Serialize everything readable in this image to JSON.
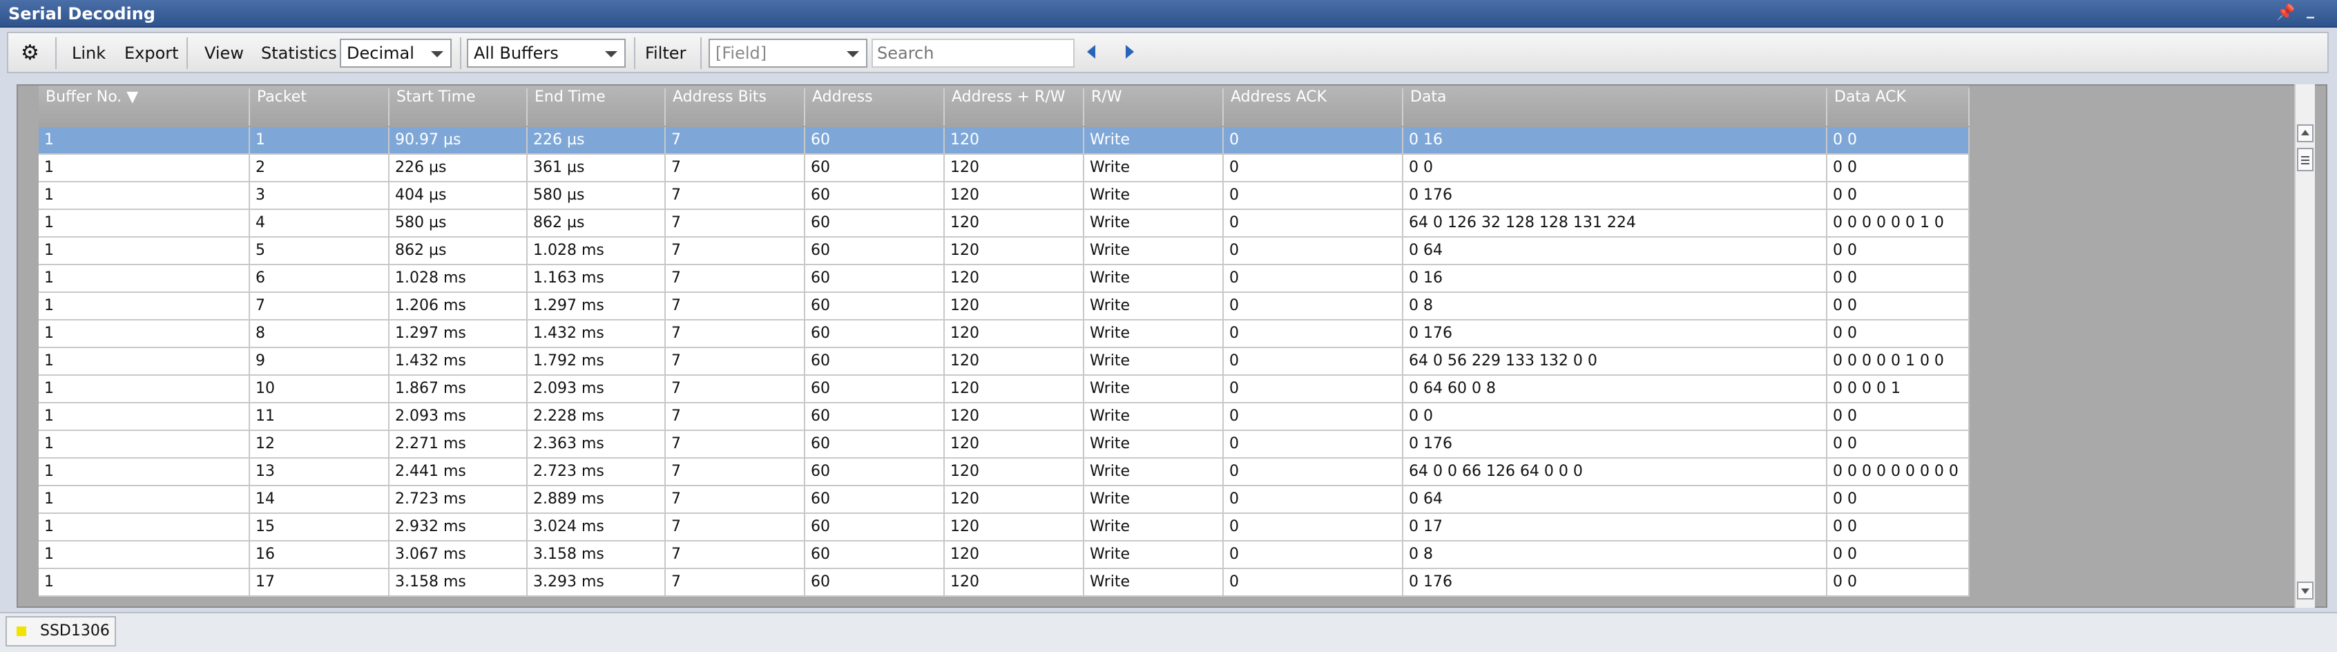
{
  "window": {
    "title": "Serial Decoding"
  },
  "toolbar": {
    "link_label": "Link",
    "export_label": "Export",
    "view_label": "View",
    "statistics_label": "Statistics",
    "format_value": "Decimal",
    "buffers_value": "All Buffers",
    "filter_label": "Filter",
    "field_placeholder": "[Field]",
    "search_placeholder": "Search"
  },
  "table": {
    "columns": [
      "Buffer No. ▼",
      "Packet",
      "Start Time",
      "End Time",
      "Address Bits",
      "Address",
      "Address + R/W",
      "R/W",
      "Address ACK",
      "Data",
      "Data ACK"
    ],
    "rows": [
      [
        "1",
        "1",
        "90.97 µs",
        "226 µs",
        "7",
        "60",
        "120",
        "Write",
        "0",
        "0 16",
        "0 0"
      ],
      [
        "1",
        "2",
        "226 µs",
        "361 µs",
        "7",
        "60",
        "120",
        "Write",
        "0",
        "0 0",
        "0 0"
      ],
      [
        "1",
        "3",
        "404 µs",
        "580 µs",
        "7",
        "60",
        "120",
        "Write",
        "0",
        "0 176",
        "0 0"
      ],
      [
        "1",
        "4",
        "580 µs",
        "862 µs",
        "7",
        "60",
        "120",
        "Write",
        "0",
        "64 0 126 32 128 128 131 224",
        "0 0 0 0 0 0 1 0"
      ],
      [
        "1",
        "5",
        "862 µs",
        "1.028 ms",
        "7",
        "60",
        "120",
        "Write",
        "0",
        "0 64",
        "0 0"
      ],
      [
        "1",
        "6",
        "1.028 ms",
        "1.163 ms",
        "7",
        "60",
        "120",
        "Write",
        "0",
        "0 16",
        "0 0"
      ],
      [
        "1",
        "7",
        "1.206 ms",
        "1.297 ms",
        "7",
        "60",
        "120",
        "Write",
        "0",
        "0 8",
        "0 0"
      ],
      [
        "1",
        "8",
        "1.297 ms",
        "1.432 ms",
        "7",
        "60",
        "120",
        "Write",
        "0",
        "0 176",
        "0 0"
      ],
      [
        "1",
        "9",
        "1.432 ms",
        "1.792 ms",
        "7",
        "60",
        "120",
        "Write",
        "0",
        "64 0 56 229 133 132 0 0",
        "0 0 0 0 0 1 0 0"
      ],
      [
        "1",
        "10",
        "1.867 ms",
        "2.093 ms",
        "7",
        "60",
        "120",
        "Write",
        "0",
        "0 64 60 0 8",
        "0 0 0 0 1"
      ],
      [
        "1",
        "11",
        "2.093 ms",
        "2.228 ms",
        "7",
        "60",
        "120",
        "Write",
        "0",
        "0 0",
        "0 0"
      ],
      [
        "1",
        "12",
        "2.271 ms",
        "2.363 ms",
        "7",
        "60",
        "120",
        "Write",
        "0",
        "0 176",
        "0 0"
      ],
      [
        "1",
        "13",
        "2.441 ms",
        "2.723 ms",
        "7",
        "60",
        "120",
        "Write",
        "0",
        "64 0 0 66 126 64 0 0 0",
        "0 0 0 0 0 0 0 0 0"
      ],
      [
        "1",
        "14",
        "2.723 ms",
        "2.889 ms",
        "7",
        "60",
        "120",
        "Write",
        "0",
        "0 64",
        "0 0"
      ],
      [
        "1",
        "15",
        "2.932 ms",
        "3.024 ms",
        "7",
        "60",
        "120",
        "Write",
        "0",
        "0 17",
        "0 0"
      ],
      [
        "1",
        "16",
        "3.067 ms",
        "3.158 ms",
        "7",
        "60",
        "120",
        "Write",
        "0",
        "0 8",
        "0 0"
      ],
      [
        "1",
        "17",
        "3.158 ms",
        "3.293 ms",
        "7",
        "60",
        "120",
        "Write",
        "0",
        "0 176",
        "0 0"
      ]
    ]
  },
  "bottom_tab": {
    "label": "SSD1306"
  }
}
